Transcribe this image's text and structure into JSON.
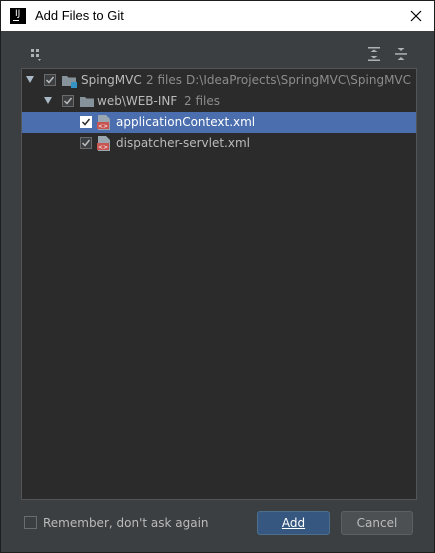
{
  "window": {
    "title": "Add Files to Git"
  },
  "toolbar": {
    "group_icon": "group-by-icon",
    "expand_icon": "expand-all-icon",
    "collapse_icon": "collapse-all-icon"
  },
  "tree": {
    "root": {
      "name": "SpingMVC",
      "count": "2 files",
      "path": "D:\\IdeaProjects\\SpringMVC\\SpingMVC",
      "checked": true
    },
    "folder": {
      "name": "web\\WEB-INF",
      "count": "2 files",
      "checked": true
    },
    "files": [
      {
        "name": "applicationContext.xml",
        "checked": true,
        "selected": true
      },
      {
        "name": "dispatcher-servlet.xml",
        "checked": true,
        "selected": false
      }
    ]
  },
  "footer": {
    "remember_label": "Remember, don't ask again",
    "remember_checked": false,
    "add_label": "Add",
    "cancel_label": "Cancel"
  },
  "colors": {
    "background": "#3c3f41",
    "tree_background": "#2b2b2b",
    "selection": "#4b6eaf",
    "primary_button": "#365880"
  }
}
